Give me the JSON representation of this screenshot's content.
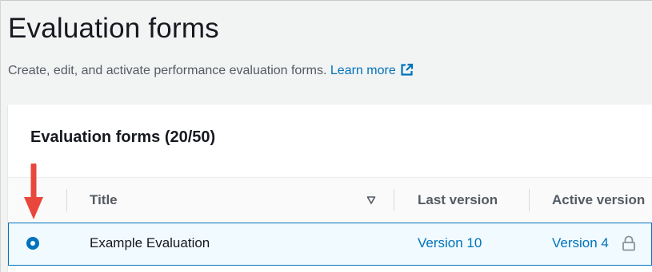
{
  "header": {
    "title": "Evaluation forms",
    "description": "Create, edit, and activate performance evaluation forms.",
    "learn_more": "Learn more"
  },
  "panel": {
    "title": "Evaluation forms (20/50)"
  },
  "table": {
    "columns": [
      "Title",
      "Last version",
      "Active version"
    ],
    "rows": [
      {
        "selected": true,
        "title": "Example Evaluation",
        "last_version": "Version 10",
        "active_version": "Version 4"
      }
    ]
  },
  "colors": {
    "link": "#0073bb",
    "selected_row_bg": "#f1faff",
    "annotation_arrow": "#e8473c"
  },
  "icons": [
    "external-link-icon",
    "sort-descending-icon",
    "lock-icon",
    "red-arrow-annotation"
  ]
}
